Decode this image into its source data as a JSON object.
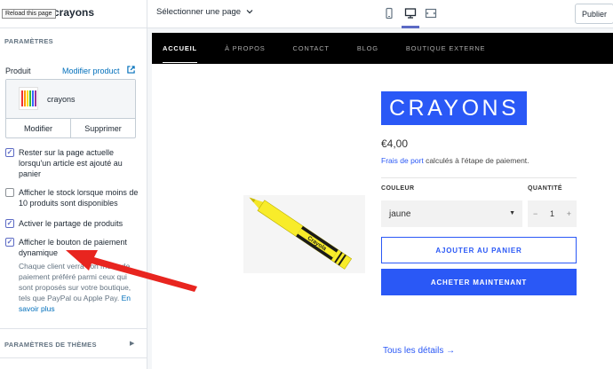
{
  "sidebar": {
    "tooltip": "Reload this page",
    "title": "crayons",
    "section_params": "PARAMÈTRES",
    "product_label": "Produit",
    "modify_product_link": "Modifier product",
    "product_card": {
      "name": "crayons",
      "edit_label": "Modifier",
      "delete_label": "Supprimer"
    },
    "options": [
      {
        "label": "Rester sur la page actuelle lorsqu'un article est ajouté au panier",
        "checked": true
      },
      {
        "label": "Afficher le stock lorsque moins de 10 produits sont disponibles",
        "checked": false
      },
      {
        "label": "Activer le partage de produits",
        "checked": true
      },
      {
        "label": "Afficher le bouton de paiement dynamique",
        "checked": true
      }
    ],
    "help_text": "Chaque client verra son mode de paiement préféré parmi ceux qui sont proposés sur votre boutique, tels que PayPal ou Apple Pay.",
    "help_link": "En savoir plus",
    "themes_section": "PARAMÈTRES DE THÈMES"
  },
  "topbar": {
    "page_select": "Sélectionner une page",
    "publish_label": "Publier",
    "active_device": "desktop"
  },
  "store": {
    "nav": [
      "ACCUEIL",
      "À PROPOS",
      "CONTACT",
      "BLOG",
      "BOUTIQUE EXTERNE"
    ],
    "product_title": "CRAYONS",
    "price": "€4,00",
    "shipping_link": "Frais de port",
    "shipping_text": " calculés à l'étape de paiement.",
    "color_label": "COULEUR",
    "color_value": "jaune",
    "qty_label": "QUANTITÉ",
    "qty_value": "1",
    "add_to_cart": "AJOUTER AU PANIER",
    "buy_now": "ACHETER MAINTENANT",
    "details_link": "Tous les détails →",
    "crayon_text": "Crayola"
  },
  "colors": {
    "accent": "#2a58f6",
    "admin_accent": "#5c6ac4",
    "link": "#006fbb",
    "annotation_arrow": "#e8251f"
  }
}
